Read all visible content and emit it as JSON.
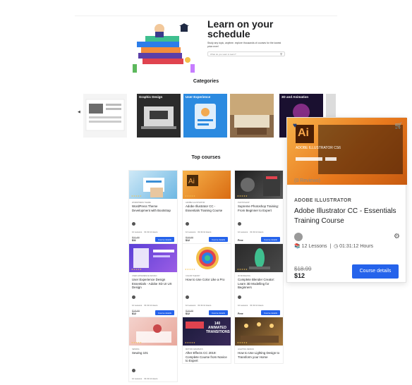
{
  "hero": {
    "title": "Learn on your schedule",
    "subtitle": "Study any topic, anytime. explore thousands of courses for the lowest price ever!",
    "search_placeholder": "What do you want to learn?"
  },
  "categories": {
    "heading": "Categories",
    "items": [
      {
        "label": ""
      },
      {
        "label": "Graphic Design"
      },
      {
        "label": "User Experience"
      },
      {
        "label": "Photography"
      },
      {
        "label": "3D and Animation"
      }
    ]
  },
  "top_courses": {
    "heading": "Top courses",
    "cards": [
      {
        "category": "WordPress Theme",
        "title": "WordPress Theme Development with Bootstrap",
        "lessons": "12 Lessons",
        "duration": "01:31:12 Hours",
        "old_price": "$11.99",
        "price": "$11",
        "button": "Course details"
      },
      {
        "category": "Adobe Illustrator",
        "title": "Adobe Illustrator CC - Essentials Training Course",
        "lessons": "12 Lessons",
        "duration": "01:31:12 Hours",
        "old_price": "$18.99",
        "price": "$12",
        "button": "Course details"
      },
      {
        "category": "Photoshop",
        "title": "Supreme Photoshop Training: From Beginner to Expert",
        "lessons": "12 Lessons",
        "duration": "01:31:12 Hours",
        "old_price": "",
        "price": "Free",
        "button": "Course details"
      },
      {
        "category": "User Experience Design",
        "title": "User Experience Design Essentials - Adobe XD UI UX Design",
        "lessons": "12 Lessons",
        "duration": "01:31:12 Hours",
        "old_price": "$18.99",
        "price": "$12",
        "button": "Course details"
      },
      {
        "category": "Color Theory",
        "title": "How to Use Color Like a Pro",
        "lessons": "12 Lessons",
        "duration": "01:31:12 Hours",
        "old_price": "$18.99",
        "price": "$12",
        "button": "Course details"
      },
      {
        "category": "3D Modeling",
        "title": "Complete Blender Creator: Learn 3D Modelling for Beginners",
        "lessons": "12 Lessons",
        "duration": "01:31:12 Hours",
        "old_price": "",
        "price": "Free",
        "button": "Course details"
      },
      {
        "category": "Sewing",
        "title": "Sewing 101",
        "lessons": "12 Lessons",
        "duration": "01:31:12 Hours",
        "old_price": "",
        "price": "",
        "button": ""
      },
      {
        "category": "Motion Graphics",
        "title": "After Effects CC 2019: Complete Course from Novice to Expert",
        "lessons": "",
        "duration": "",
        "old_price": "",
        "price": "",
        "button": "",
        "thumb_text": "140 ANIMATED TRANSITIONS"
      },
      {
        "category": "Lighting Design",
        "title": "How to Use Lighting Design to Transform your Home",
        "lessons": "",
        "duration": "",
        "old_price": "",
        "price": "",
        "button": ""
      }
    ]
  },
  "featured_card": {
    "category": "ADOBE ILLUSTRATOR",
    "title": "Adobe Illustrator CC - Essentials Training Course",
    "reviews": "(0 Reviews)",
    "lessons": "12 Lessons",
    "duration": "01:31:12 Hours",
    "old_price": "$18.99",
    "price": "$12",
    "button": "Course details",
    "thumb_text": "Ai",
    "thumb_caption": "ADOBE ILLUSTRATOR CS6"
  },
  "colors": {
    "accent": "#2563eb",
    "star": "#f4c150",
    "heart": "#1c3d7a"
  }
}
